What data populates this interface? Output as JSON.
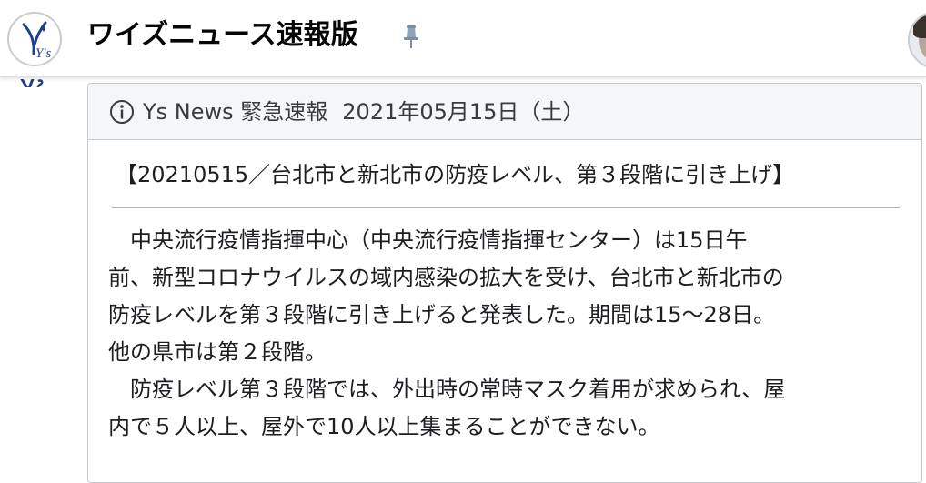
{
  "header": {
    "logo_text": "Y's",
    "page_name": "ワイズニュース速報版",
    "pin_icon": "pin-icon",
    "profile_avatar": "avatar"
  },
  "post": {
    "header_icon": "info-icon",
    "source": "Ys News 緊急速報",
    "date": "2021年05月15日（土）",
    "headline": "【20210515／台北市と新北市の防疫レベル、第３段階に引き上げ】",
    "body_lines": [
      "　中央流行疫情指揮中心（中央流行疫情指揮センター）は15日午",
      "前、新型コロナウイルスの域内感染の拡大を受け、台北市と新北市の",
      "防疫レベルを第３段階に引き上げると発表した。期間は15〜28日。",
      "他の県市は第２段階。",
      "　防疫レベル第３段階では、外出時の常時マスク着用が求められ、屋",
      "内で５人以上、屋外で10人以上集まることができない。"
    ]
  },
  "colors": {
    "header_bg": "#ffffff",
    "card_header_bg": "#f5f6f7",
    "border": "#c6c8cc",
    "rule": "#aab6c7",
    "text": "#1c1e21",
    "logo_blue": "#1f3e8c"
  }
}
